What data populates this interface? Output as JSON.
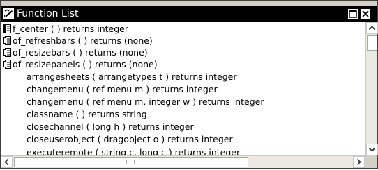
{
  "window": {
    "title": "Function List",
    "title_icon": "function-list-icon",
    "buttons": [
      "restore-icon",
      "close-icon"
    ]
  },
  "functions": [
    {
      "label": "f_center ( )  returns integer",
      "icon": "script-book-icon"
    },
    {
      "label": "of_refreshbars ( ) returns (none)",
      "icon": "script-scroll-icon"
    },
    {
      "label": "of_resizebars ( ) returns (none)",
      "icon": "script-scroll-icon"
    },
    {
      "label": "of_resizepanels ( ) returns (none)",
      "icon": "script-scroll-icon"
    },
    {
      "label": "arrangesheets ( arrangetypes t )  returns integer",
      "icon": ""
    },
    {
      "label": "changemenu ( ref menu m )  returns integer",
      "icon": ""
    },
    {
      "label": "changemenu ( ref menu m, integer w )  returns integer",
      "icon": ""
    },
    {
      "label": "classname ( )  returns string",
      "icon": ""
    },
    {
      "label": "closechannel ( long h )  returns integer",
      "icon": ""
    },
    {
      "label": "closeuserobject ( dragobject o )  returns integer",
      "icon": ""
    },
    {
      "label": "executeremote ( string c, long c )  returns integer",
      "icon": ""
    }
  ],
  "colors": {
    "titlebar": "#000000",
    "title_text": "#ffffff",
    "scrollbar_track": "#ece9e2"
  }
}
